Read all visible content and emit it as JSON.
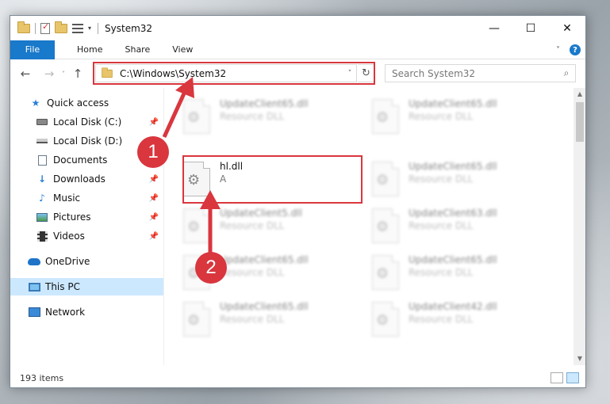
{
  "window": {
    "title": "System32",
    "controls": {
      "minimize": "—",
      "maximize": "☐",
      "close": "✕"
    }
  },
  "ribbon": {
    "tabs": [
      "File",
      "Home",
      "Share",
      "View"
    ],
    "collapse_glyph": "˅",
    "help_glyph": "?"
  },
  "navigation": {
    "back": "←",
    "forward": "→",
    "recent": "˅",
    "up": "↑",
    "address": "C:\\Windows\\System32",
    "address_caret": "˅",
    "refresh": "↻",
    "search_placeholder": "Search System32",
    "search_glyph": "⌕"
  },
  "sidebar": {
    "items": [
      {
        "label": "Quick access",
        "icon": "star-icon",
        "pinned": false
      },
      {
        "label": "Local Disk (C:)",
        "icon": "drive-icon",
        "pinned": true
      },
      {
        "label": "Local Disk (D:)",
        "icon": "drive-icon",
        "pinned": false
      },
      {
        "label": "Documents",
        "icon": "document-icon",
        "pinned": true
      },
      {
        "label": "Downloads",
        "icon": "download-icon",
        "pinned": true
      },
      {
        "label": "Music",
        "icon": "music-icon",
        "pinned": true
      },
      {
        "label": "Pictures",
        "icon": "pictures-icon",
        "pinned": true
      },
      {
        "label": "Videos",
        "icon": "videos-icon",
        "pinned": true
      },
      {
        "label": "OneDrive",
        "icon": "onedrive-icon",
        "pinned": false
      },
      {
        "label": "This PC",
        "icon": "this-pc-icon",
        "pinned": false,
        "selected": true
      },
      {
        "label": "Network",
        "icon": "network-icon",
        "pinned": false
      }
    ],
    "pin_glyph": "📌"
  },
  "files": [
    {
      "name": "UpdateClient65.dll",
      "desc": "Resource DLL"
    },
    {
      "name": "UpdateClient65.dll",
      "desc": "Resource DLL"
    },
    {
      "name": "hl.dll",
      "desc": "A"
    },
    {
      "name": "UpdateClient65.dll",
      "desc": "Resource DLL"
    },
    {
      "name": "UpdateClient5.dll",
      "desc": "Resource DLL"
    },
    {
      "name": "UpdateClient63.dll",
      "desc": "Resource DLL"
    },
    {
      "name": "UpdateClient65.dll",
      "desc": "Resource DLL"
    },
    {
      "name": "UpdateClient65.dll",
      "desc": "Resource DLL"
    },
    {
      "name": "UpdateClient65.dll",
      "desc": "Resource DLL"
    },
    {
      "name": "UpdateClient42.dll",
      "desc": "Resource DLL"
    }
  ],
  "status": {
    "item_count": "193 items"
  },
  "annotations": {
    "marker_1": "1",
    "marker_2": "2",
    "color": "#d9363e"
  }
}
